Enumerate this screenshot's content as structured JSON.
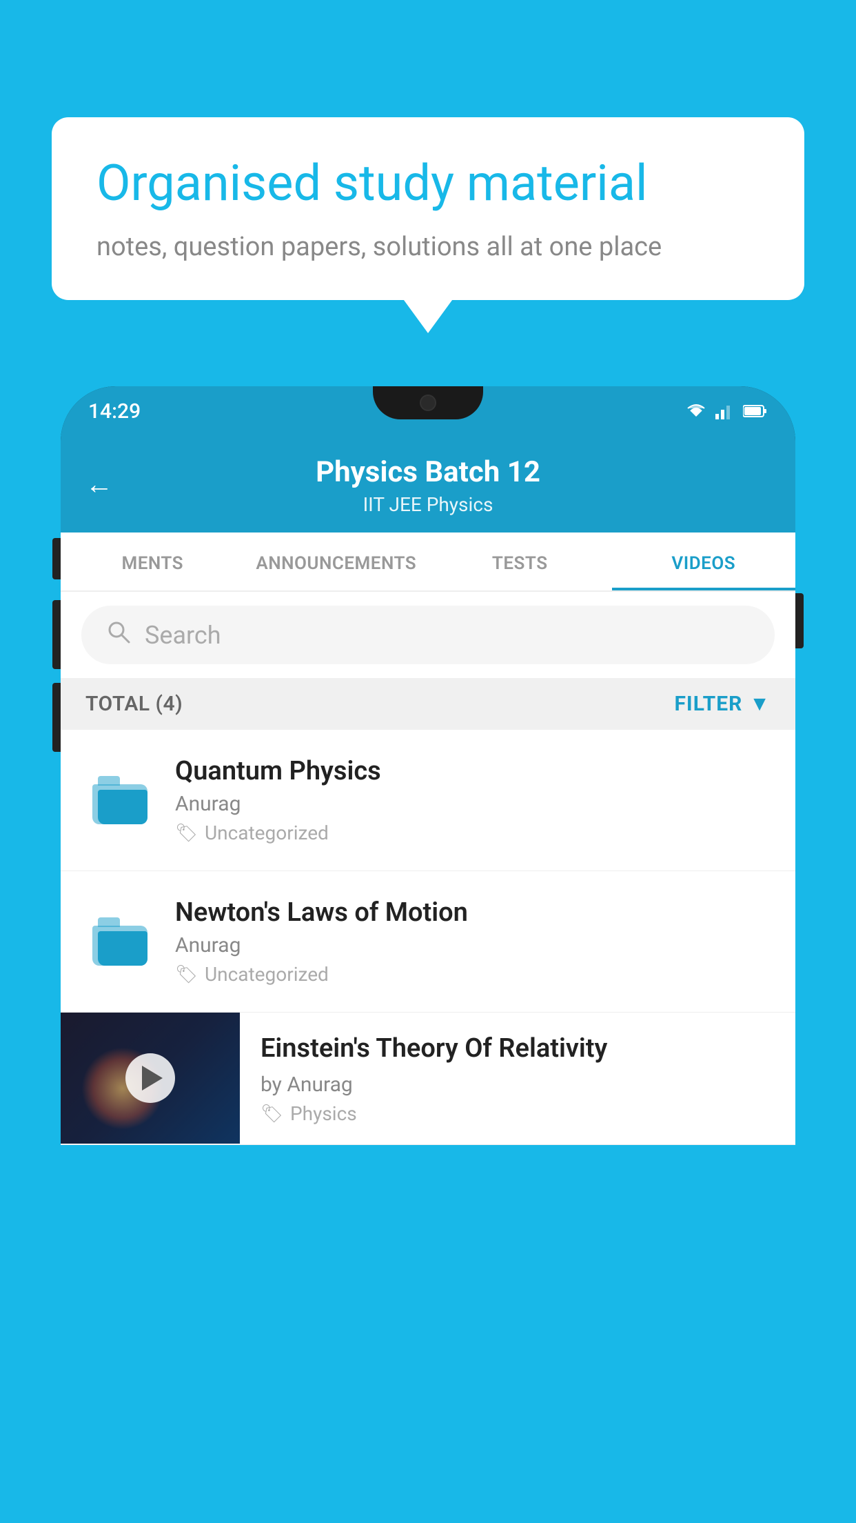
{
  "background_color": "#18B8E8",
  "speech_bubble": {
    "heading": "Organised study material",
    "subtext": "notes, question papers, solutions all at one place"
  },
  "phone": {
    "status_bar": {
      "time": "14:29"
    },
    "header": {
      "title": "Physics Batch 12",
      "subtitle": "IIT JEE   Physics",
      "back_label": "←"
    },
    "tabs": [
      {
        "label": "MENTS",
        "active": false
      },
      {
        "label": "ANNOUNCEMENTS",
        "active": false
      },
      {
        "label": "TESTS",
        "active": false
      },
      {
        "label": "VIDEOS",
        "active": true
      }
    ],
    "search": {
      "placeholder": "Search"
    },
    "filter_bar": {
      "total_label": "TOTAL (4)",
      "filter_label": "FILTER"
    },
    "items": [
      {
        "type": "folder",
        "title": "Quantum Physics",
        "author": "Anurag",
        "tag": "Uncategorized"
      },
      {
        "type": "folder",
        "title": "Newton's Laws of Motion",
        "author": "Anurag",
        "tag": "Uncategorized"
      },
      {
        "type": "video",
        "title": "Einstein's Theory Of Relativity",
        "author": "by Anurag",
        "tag": "Physics"
      }
    ]
  }
}
